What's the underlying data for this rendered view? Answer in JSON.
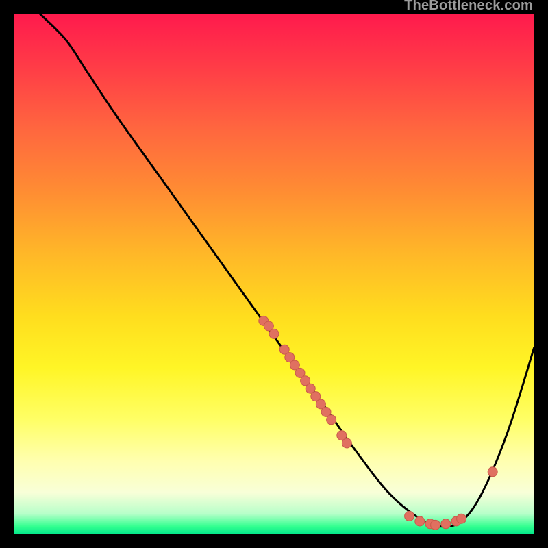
{
  "watermark": "TheBottleneck.com",
  "colors": {
    "curve": "#000000",
    "dot_fill": "#e07060",
    "dot_stroke": "#c85a4a",
    "border": "#000000"
  },
  "chart_data": {
    "type": "line",
    "xlim": [
      0,
      100
    ],
    "ylim": [
      0,
      100
    ],
    "xlabel": "",
    "ylabel": "",
    "title": "",
    "line_points": [
      {
        "x": 5,
        "y": 100
      },
      {
        "x": 10,
        "y": 95
      },
      {
        "x": 14,
        "y": 89
      },
      {
        "x": 20,
        "y": 80
      },
      {
        "x": 30,
        "y": 66
      },
      {
        "x": 40,
        "y": 52
      },
      {
        "x": 50,
        "y": 38
      },
      {
        "x": 58,
        "y": 27
      },
      {
        "x": 65,
        "y": 17
      },
      {
        "x": 72,
        "y": 8
      },
      {
        "x": 78,
        "y": 3
      },
      {
        "x": 82,
        "y": 1.5
      },
      {
        "x": 86,
        "y": 2.5
      },
      {
        "x": 90,
        "y": 8
      },
      {
        "x": 95,
        "y": 20
      },
      {
        "x": 100,
        "y": 36
      }
    ],
    "dots": [
      {
        "x": 48,
        "y": 41
      },
      {
        "x": 49,
        "y": 40
      },
      {
        "x": 50,
        "y": 38.5
      },
      {
        "x": 52,
        "y": 35.5
      },
      {
        "x": 53,
        "y": 34
      },
      {
        "x": 54,
        "y": 32.5
      },
      {
        "x": 55,
        "y": 31
      },
      {
        "x": 56,
        "y": 29.5
      },
      {
        "x": 57,
        "y": 28
      },
      {
        "x": 58,
        "y": 26.5
      },
      {
        "x": 59,
        "y": 25
      },
      {
        "x": 60,
        "y": 23.5
      },
      {
        "x": 61,
        "y": 22
      },
      {
        "x": 63,
        "y": 19
      },
      {
        "x": 64,
        "y": 17.5
      },
      {
        "x": 76,
        "y": 3.5
      },
      {
        "x": 78,
        "y": 2.5
      },
      {
        "x": 80,
        "y": 2
      },
      {
        "x": 81,
        "y": 1.8
      },
      {
        "x": 83,
        "y": 2
      },
      {
        "x": 85,
        "y": 2.5
      },
      {
        "x": 86,
        "y": 3
      },
      {
        "x": 92,
        "y": 12
      }
    ]
  }
}
